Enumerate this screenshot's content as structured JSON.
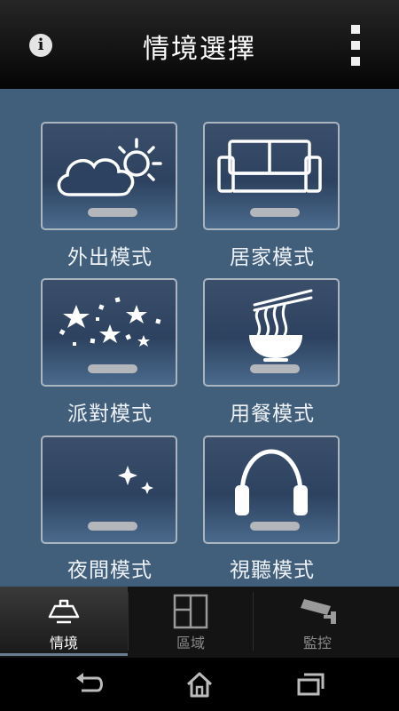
{
  "header": {
    "title": "情境選擇",
    "info_icon": "info-icon",
    "menu_icon": "overflow-menu-icon"
  },
  "scenes": [
    {
      "label": "外出模式",
      "icon": "weather-cloud-sun-icon"
    },
    {
      "label": "居家模式",
      "icon": "sofa-icon"
    },
    {
      "label": "派對模式",
      "icon": "party-stars-icon"
    },
    {
      "label": "用餐模式",
      "icon": "noodle-bowl-icon"
    },
    {
      "label": "夜間模式",
      "icon": "moon-stars-icon"
    },
    {
      "label": "視聽模式",
      "icon": "headphones-icon"
    }
  ],
  "tabs": [
    {
      "label": "情境",
      "icon": "lamp-icon",
      "active": true
    },
    {
      "label": "區域",
      "icon": "floorplan-icon",
      "active": false
    },
    {
      "label": "監控",
      "icon": "security-camera-icon",
      "active": false
    }
  ],
  "nav": {
    "back_icon": "back-icon",
    "home_icon": "home-icon",
    "recents_icon": "recent-apps-icon"
  },
  "colors": {
    "background": "#415f7b",
    "tile_border": "#aab5c0",
    "header": "#1a1a1a"
  }
}
